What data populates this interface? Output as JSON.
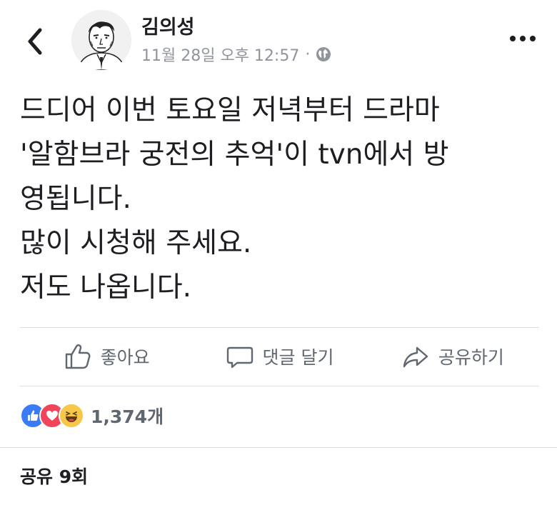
{
  "post": {
    "author": "김의성",
    "timestamp": "11월 28일 오후 12:57",
    "separator": "·",
    "audience_icon": "globe-icon",
    "text": "드디어 이번 토요일 저녁부터 드라마\n'알함브라 궁전의 추억'이 tvn에서 방\n영됩니다.\n많이 시청해 주세요.\n저도 나옵니다."
  },
  "actions": {
    "like_label": "좋아요",
    "comment_label": "댓글 달기",
    "share_label": "공유하기"
  },
  "reactions": {
    "count": "1,374개",
    "types": [
      "like",
      "love",
      "haha"
    ]
  },
  "shares": {
    "label": "공유 9회"
  },
  "colors": {
    "like_blue": "#3b7bf6",
    "love_red": "#f0445b",
    "haha_yellow": "#f7c74a",
    "secondary_text": "#606770"
  }
}
